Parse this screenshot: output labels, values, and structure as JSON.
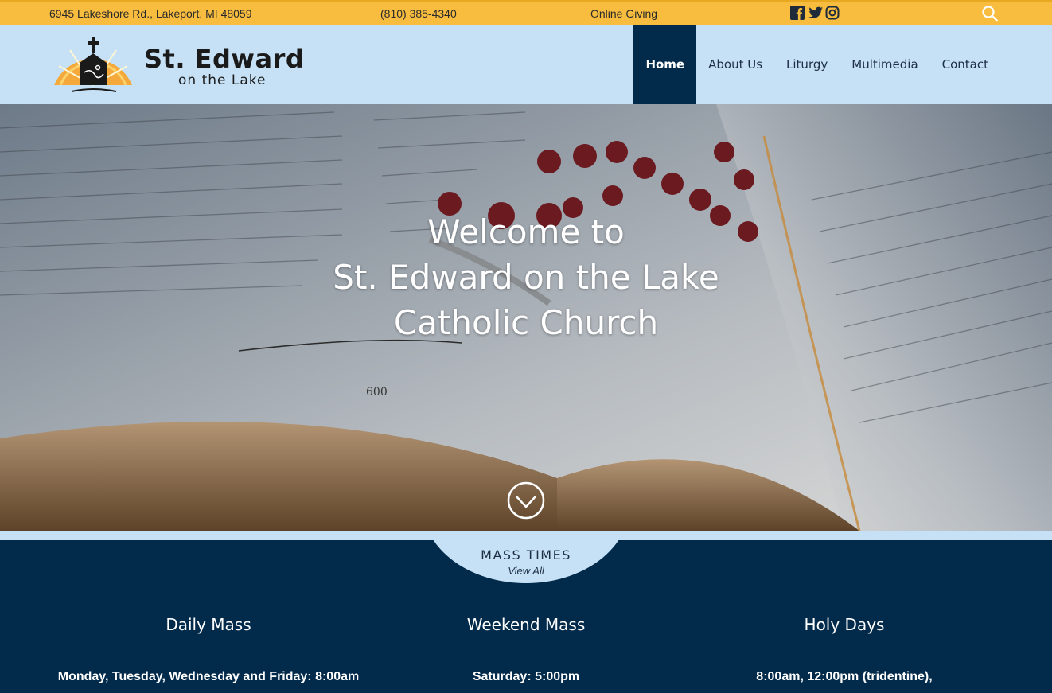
{
  "topbar": {
    "address": "6945 Lakeshore Rd., Lakeport, MI 48059",
    "phone": "(810) 385-4340",
    "giving": "Online Giving",
    "social_icons": [
      "facebook-icon",
      "twitter-icon",
      "instagram-icon"
    ],
    "search_icon": "search-icon"
  },
  "header": {
    "logo_main": "St. Edward",
    "logo_sub": "on the Lake",
    "nav": [
      {
        "label": "Home",
        "active": true
      },
      {
        "label": "About Us",
        "active": false
      },
      {
        "label": "Liturgy",
        "active": false
      },
      {
        "label": "Multimedia",
        "active": false
      },
      {
        "label": "Contact",
        "active": false
      }
    ]
  },
  "hero": {
    "title_line1": "Welcome to",
    "title_line2": "St. Edward on the Lake",
    "title_line3": "Catholic Church"
  },
  "mass": {
    "tab_title": "MASS TIMES",
    "tab_link": "View All",
    "columns": [
      {
        "heading": "Daily Mass",
        "line1": "Monday, Tuesday, Wednesday and Friday: 8:00am"
      },
      {
        "heading": "Weekend Mass",
        "line1": "Saturday: 5:00pm"
      },
      {
        "heading": "Holy Days",
        "line1": "8:00am, 12:00pm (tridentine),"
      }
    ]
  },
  "colors": {
    "topbar": "#f8bd3e",
    "header": "#c6e1f5",
    "navy": "#022a4a"
  }
}
